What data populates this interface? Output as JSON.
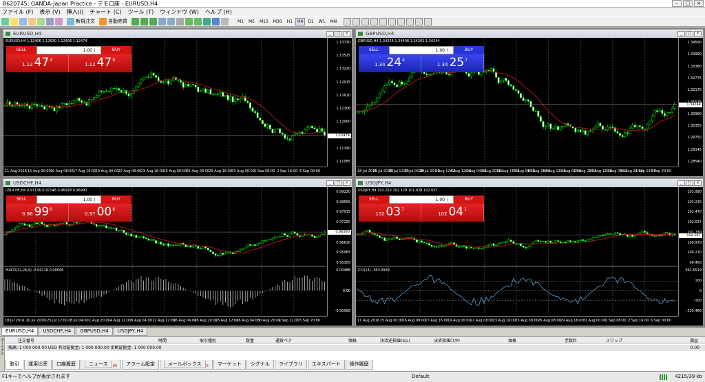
{
  "title": "8620745: OANDA-Japan Practice - デモ口座 - EURUSD,H4",
  "menu": [
    "ファイル (F)",
    "表示 (V)",
    "挿入(I)",
    "チャート (C)",
    "ツール (T)",
    "ウィンドウ (W)",
    "ヘルプ (H)"
  ],
  "toolbar": {
    "new_order": "新規注文",
    "auto_trade": "自動売買",
    "timeframes": [
      "M1",
      "M5",
      "M15",
      "M30",
      "H1",
      "H4",
      "D1",
      "W1",
      "MN"
    ],
    "active_tf": "H4"
  },
  "charts": [
    {
      "caption": "EURUSD,H4",
      "info": "EURUSD,H4  1.12406 1.12630 1.12406 1.12474",
      "theme": "red",
      "sell_label": "SELL",
      "buy_label": "BUY",
      "lot": "1.00",
      "sell": {
        "small": "1.12",
        "big": "47",
        "sup": "4"
      },
      "buy": {
        "small": "1.12",
        "big": "47",
        "sup": "9"
      },
      "y_ticks": [
        "1.13730",
        "1.13525",
        "1.13220",
        "1.12915",
        "1.12610",
        "1.12306",
        "1.12000",
        "1.11695",
        "1.11390",
        "1.11085"
      ],
      "current": "1.12474",
      "x_ticks": [
        "11 Aug 2016",
        "15 Aug 00:00",
        "16 Aug 08:00",
        "17 Aug 16:00",
        "19 Aug 00:00",
        "22 Aug 08:00",
        "23 Aug 16:00",
        "25 Aug 00:00",
        "26 Aug 08:00",
        "29 Aug 16:00",
        "31 Aug 00:00",
        "1 Sep 08:00",
        "2 Sep 16:00",
        "6 Sep 00:00"
      ]
    },
    {
      "caption": "GBPUSD,H4",
      "info": "GBPUSD,H4  1.34224 1.34408 1.34202 1.34244",
      "theme": "blue",
      "sell_label": "SELL",
      "buy_label": "BUY",
      "lot": "1.00",
      "sell": {
        "small": "1.34",
        "big": "24",
        "sup": "4"
      },
      "buy": {
        "small": "1.34",
        "big": "25",
        "sup": "7"
      },
      "y_ticks": [
        "1.34590",
        "1.33990",
        "1.33380",
        "1.32775",
        "1.32170",
        "1.31575",
        "1.30960",
        "1.30355",
        "1.29750",
        "1.29145",
        "1.28540"
      ],
      "current": "1.34244",
      "x_ticks": [
        "18 Jul 2016",
        "20 Jul 20:00",
        "25 Jul 12:00",
        "27 Jul 04:00",
        "28 Jul 20:00",
        "1 Aug 12:00",
        "4 Aug 12:00",
        "8 Aug 04:00",
        "9 Aug 20:00",
        "11 Aug 12:00",
        "15 Aug 04:00",
        "16 Aug 20:00",
        "18 Aug 12:00",
        "22 Aug 04:00",
        "23 Aug 20:00",
        "25 Aug 12:00",
        "29 Aug 04:00",
        "30 Aug 20:00",
        "1 Sep 12:00",
        "5 Sep 20:00"
      ]
    },
    {
      "caption": "USDCHF,H4",
      "info": "USDCHF,H4  0.97136 0.97146 0.96928 0.96990",
      "theme": "red",
      "sell_label": "SELL",
      "buy_label": "BUY",
      "lot": "1.00",
      "sell": {
        "small": "0.96",
        "big": "99",
        "sup": "0"
      },
      "buy": {
        "small": "0.97",
        "big": "00",
        "sup": "6"
      },
      "y_ticks": [
        "0.99220",
        "0.98555",
        "0.97915",
        "0.97255",
        "0.96990",
        "0.96610",
        "0.95965",
        "0.95305"
      ],
      "current": "0.96990",
      "macd_label": "MACD(12,26,9) -0.00116 0.00006",
      "macd_ticks": [
        "0.00488",
        "0.00",
        "-0.00568"
      ],
      "x_ticks": [
        "18 Jul 2016",
        "20 Jul 20:00",
        "25 Jul 12:00",
        "28 Jul 04:00",
        "1 Aug 20:00",
        "4 Aug 12:00",
        "9 Aug 04:00",
        "11 Aug 12:00",
        "16 Aug 04:00",
        "18 Aug 20:00",
        "23 Aug 12:00",
        "26 Aug 04:00",
        "30 Aug 20:00",
        "2 Sep 12:00",
        "5 Sep 20:00"
      ]
    },
    {
      "caption": "USDJPY,H4",
      "info": "USDJPY,H4  102.152 102.179 101.928 102.037",
      "theme": "red",
      "sell_label": "SELL",
      "buy_label": "BUY",
      "lot": "1.00",
      "sell": {
        "small": "102",
        "big": "03",
        "sup": "7"
      },
      "buy": {
        "small": "102",
        "big": "04",
        "sup": "1"
      },
      "y_ticks": [
        "103.990",
        "103.230",
        "102.470",
        "102.037",
        "101.730",
        "100.970",
        "100.210",
        "99.450"
      ],
      "current": "102.037",
      "cci_label": "CCI(14) -263.0939",
      "cci_ticks": [
        "392.6519",
        "100",
        "0",
        "-100",
        "-335.466"
      ],
      "x_ticks": [
        "11 Aug 2016",
        "15 Aug 00:00",
        "16 Aug 08:00",
        "17 Aug 16:00",
        "19 Aug 00:00",
        "22 Aug 08:00",
        "23 Aug 16:00",
        "25 Aug 00:00",
        "26 Aug 08:00",
        "29 Aug 16:00",
        "31 Aug 00:00",
        "1 Sep 08:00",
        "2 Sep 16:00",
        "6 Sep 00:00"
      ]
    }
  ],
  "window_tabs": [
    "EURUSD,H4",
    "USDCHF,H4",
    "GBPUSD,H4",
    "USDJPY,H4"
  ],
  "terminal": {
    "headers": [
      "注文番号",
      "時間",
      "取引種別",
      "数量",
      "通貨ペア",
      "価格",
      "決済逆指値(S/L)",
      "決済指値(T/P)",
      "価格",
      "手数料",
      "スワップ",
      "損益"
    ],
    "balance_row": "残高: 1 000 000.00 USD  有効証拠金: 1 000 000.00  余剰証拠金: 1 000 000.00",
    "balance_value": "0.00",
    "tabs": [
      "取引",
      "運用比率",
      "口座履歴",
      "ニュース",
      "アラーム設定",
      "メールボックス",
      "マーケット",
      "シグナル",
      "ライブラリ",
      "エキスパート",
      "操作履歴"
    ],
    "news_badge": "99",
    "mail_badge": "6",
    "side_label": "ターミナル"
  },
  "status": {
    "help": "F1キーでヘルプが表示されます",
    "profile": "Default",
    "traffic": "4215/39 kb"
  }
}
